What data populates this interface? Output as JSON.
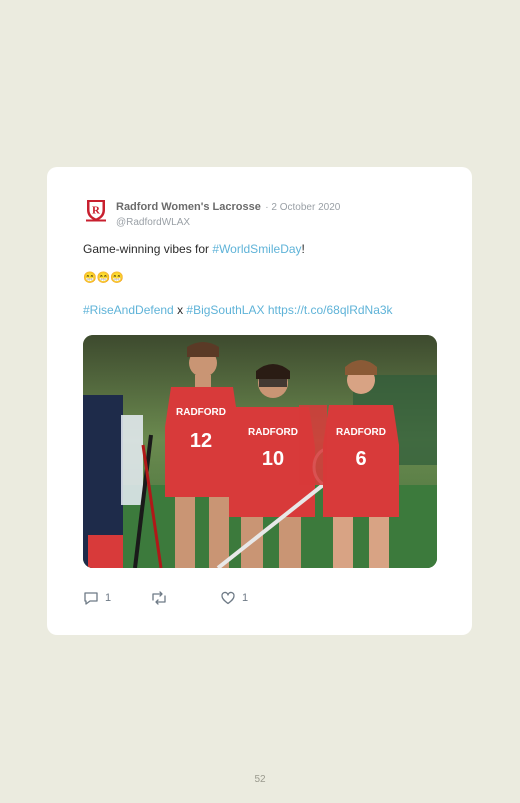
{
  "tweet": {
    "author_name": "Radford Women's Lacrosse",
    "date": "· 2 October 2020",
    "handle": "@RadfordWLAX",
    "line1_text": "Game-winning vibes for ",
    "line1_hashtag": "#WorldSmileDay",
    "line1_end": "!",
    "emojis": "😁😁😁",
    "hashtag_rise": "#RiseAndDefend",
    "x_text": " x ",
    "hashtag_bigsouth": "#BigSouthLAX",
    "short_link": "https://t.co/68qlRdNa3k",
    "photo_alt": "Radford lacrosse players celebrating on the field",
    "reply_count": "1",
    "like_count": "1"
  },
  "page": {
    "number": "52"
  },
  "colors": {
    "link": "#5fb3d8",
    "jersey": "#d83a3a",
    "background": "#ebebdf"
  },
  "icons": [
    "radford-logo-icon",
    "reply-icon",
    "retweet-icon",
    "like-icon"
  ]
}
